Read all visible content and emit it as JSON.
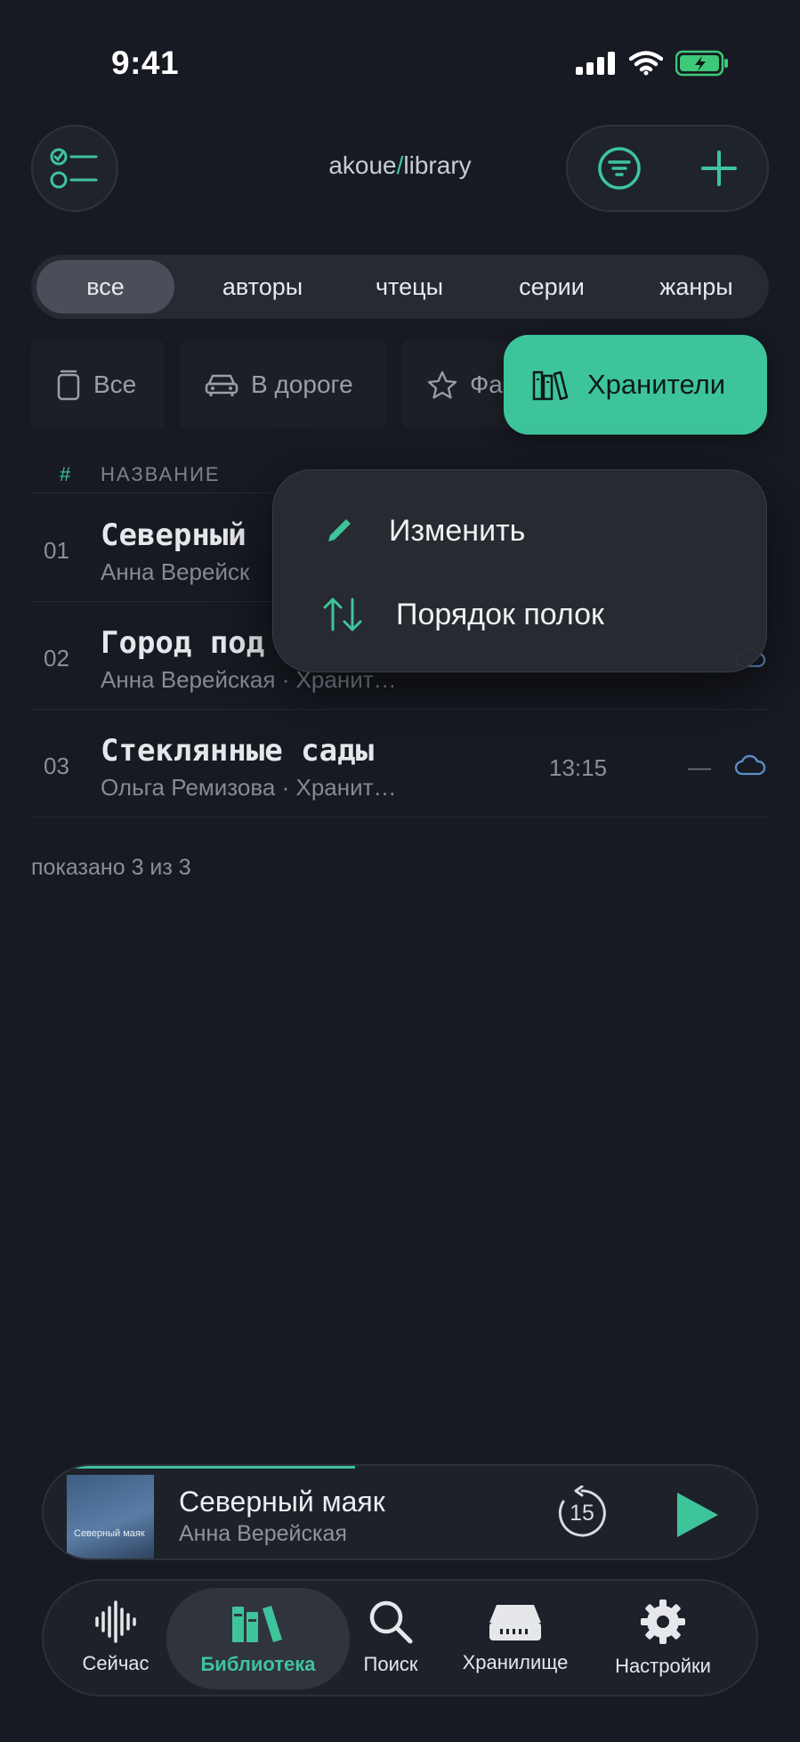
{
  "status_bar": {
    "time": "9:41"
  },
  "header": {
    "title_prefix": "akoue",
    "title_sep": "/",
    "title_suffix": "library"
  },
  "segments": [
    {
      "label": "все",
      "active": true
    },
    {
      "label": "авторы",
      "active": false
    },
    {
      "label": "чтецы",
      "active": false
    },
    {
      "label": "серии",
      "active": false
    },
    {
      "label": "жанры",
      "active": false
    }
  ],
  "shelves": [
    {
      "label": "Все",
      "icon": "jar-icon"
    },
    {
      "label": "В дороге",
      "icon": "car-icon"
    },
    {
      "label": "Фа",
      "icon": "star-icon"
    },
    {
      "label": "Хранители",
      "icon": "books-icon",
      "active": true
    }
  ],
  "table": {
    "headers": {
      "num": "#",
      "title": "НАЗВАНИЕ"
    },
    "rows": [
      {
        "num": "01",
        "title": "Северный",
        "subtitle": "Анна Верейск",
        "duration": "",
        "progress": ""
      },
      {
        "num": "02",
        "title": "Город под",
        "subtitle": "Анна Верейская · Хранит…",
        "duration": "",
        "progress": ""
      },
      {
        "num": "03",
        "title": "Стеклянные сады",
        "subtitle": "Ольга Ремизова · Хранит…",
        "duration": "13:15",
        "progress": "—"
      }
    ],
    "shown": "показано 3 из 3"
  },
  "context_menu": {
    "items": [
      {
        "label": "Изменить",
        "icon": "pencil-icon"
      },
      {
        "label": "Порядок полок",
        "icon": "sort-arrows-icon"
      }
    ]
  },
  "mini_player": {
    "title": "Северный маяк",
    "artist": "Анна Верейская",
    "cover_text": "Северный маяк",
    "skip_label": "15",
    "progress": 0.4
  },
  "tabs": [
    {
      "label": "Сейчас",
      "icon": "waveform-icon"
    },
    {
      "label": "Библиотека",
      "icon": "library-icon",
      "active": true
    },
    {
      "label": "Поиск",
      "icon": "search-icon"
    },
    {
      "label": "Хранилище",
      "icon": "storage-icon"
    },
    {
      "label": "Настройки",
      "icon": "gear-icon"
    }
  ],
  "colors": {
    "accent": "#3ec49b",
    "background": "#171a22",
    "cloud": "#5b8fc7"
  }
}
